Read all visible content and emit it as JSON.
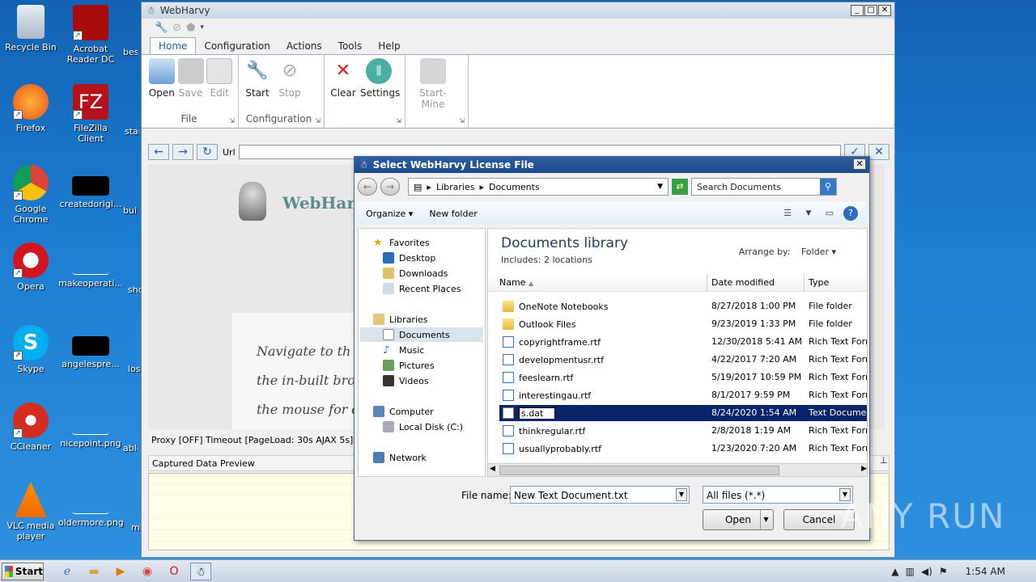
{
  "desktop": {
    "icons": [
      {
        "label": "Recycle Bin"
      },
      {
        "label": "Acrobat Reader DC"
      },
      {
        "label": "Firefox"
      },
      {
        "label": "FileZilla Client"
      },
      {
        "label": "Google Chrome"
      },
      {
        "label": "createdorigi..."
      },
      {
        "label": "Opera"
      },
      {
        "label": "makeoperati..."
      },
      {
        "label": "Skype"
      },
      {
        "label": "angelespre..."
      },
      {
        "label": "CCleaner"
      },
      {
        "label": "nicepoint.png"
      },
      {
        "label": "VLC media player"
      },
      {
        "label": "oldermore.png"
      }
    ],
    "cut_labels": [
      "best",
      "star",
      "buil",
      "sho",
      "los",
      "able",
      "mi"
    ]
  },
  "webharvy": {
    "title": "WebHarvy",
    "menu_tabs": [
      "Home",
      "Configuration",
      "Actions",
      "Tools",
      "Help"
    ],
    "groups": {
      "file": {
        "label": "File",
        "buttons": [
          "Open",
          "Save",
          "Edit"
        ]
      },
      "configuration": {
        "label": "Configuration",
        "buttons": [
          "Start",
          "Stop"
        ]
      },
      "misc": {
        "buttons": [
          "Clear",
          "Settings"
        ]
      },
      "mine": {
        "buttons": [
          "Start-Mine"
        ]
      }
    },
    "url_label": "Url",
    "url_value": "",
    "logo_text": "WebHarv",
    "page_lines": [
      "Navigate to th",
      "the in-built bro",
      "the mouse for d"
    ],
    "status": "Proxy [OFF] Timeout [PageLoad: 30s AJAX 5s] Mine",
    "captured_label": "Captured Data Preview"
  },
  "dialog": {
    "title": "Select WebHarvy License File",
    "breadcrumbs": [
      "Libraries",
      "Documents"
    ],
    "search_placeholder": "Search Documents",
    "organize": "Organize",
    "new_folder": "New folder",
    "nav": {
      "favorites": "Favorites",
      "desktop": "Desktop",
      "downloads": "Downloads",
      "recent": "Recent Places",
      "libraries": "Libraries",
      "documents": "Documents",
      "music": "Music",
      "pictures": "Pictures",
      "videos": "Videos",
      "computer": "Computer",
      "local_disk": "Local Disk (C:)",
      "network": "Network"
    },
    "library_title": "Documents library",
    "library_sub": "Includes:  2 locations",
    "arrange_label": "Arrange by:",
    "arrange_value": "Folder",
    "columns": [
      "Name",
      "Date modified",
      "Type"
    ],
    "files": [
      {
        "name": "OneNote Notebooks",
        "date": "8/27/2018 1:00 PM",
        "type": "File folder",
        "kind": "folder"
      },
      {
        "name": "Outlook Files",
        "date": "9/23/2019 1:33 PM",
        "type": "File folder",
        "kind": "folder"
      },
      {
        "name": "copyrightframe.rtf",
        "date": "12/30/2018 5:41 AM",
        "type": "Rich Text Forma",
        "kind": "rtf"
      },
      {
        "name": "developmentusr.rtf",
        "date": "4/22/2017 7:20 AM",
        "type": "Rich Text Forma",
        "kind": "rtf"
      },
      {
        "name": "feeslearn.rtf",
        "date": "5/19/2017 10:59 PM",
        "type": "Rich Text Forma",
        "kind": "rtf"
      },
      {
        "name": "interestingau.rtf",
        "date": "8/1/2017 9:59 PM",
        "type": "Rich Text Forma",
        "kind": "rtf"
      },
      {
        "name": "s.dat",
        "date": "8/24/2020 1:54 AM",
        "type": "Text Document",
        "kind": "txt",
        "selected": true
      },
      {
        "name": "thinkregular.rtf",
        "date": "2/8/2018 1:19 AM",
        "type": "Rich Text Forma",
        "kind": "rtf"
      },
      {
        "name": "usuallyprobably.rtf",
        "date": "1/23/2020 7:20 AM",
        "type": "Rich Text Forma",
        "kind": "rtf"
      }
    ],
    "file_name_label": "File name:",
    "file_name_value": "New Text Document.txt",
    "file_type_value": "All files (*.*)",
    "open": "Open",
    "cancel": "Cancel"
  },
  "watermark": "ANY RUN",
  "taskbar": {
    "start": "Start",
    "time": "1:54 AM"
  }
}
